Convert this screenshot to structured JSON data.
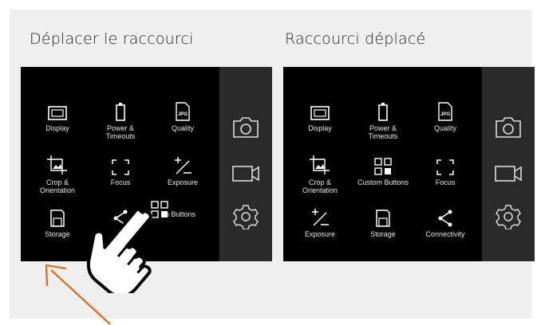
{
  "left": {
    "title": "Déplacer le raccourci",
    "tiles": [
      {
        "label": "Display",
        "icon": "display-icon"
      },
      {
        "label": "Power &\nTimeouts",
        "icon": "battery-icon"
      },
      {
        "label": "Quality",
        "icon": "jpg-file-icon"
      },
      {
        "label": "Crop &\nOrientation",
        "icon": "crop-icon"
      },
      {
        "label": "Focus",
        "icon": "focus-frame-icon"
      },
      {
        "label": "Exposure",
        "icon": "plus-minus-icon"
      },
      {
        "label": "Storage",
        "icon": "sd-card-icon"
      },
      {
        "label": "",
        "icon": "share-icon"
      },
      {
        "label": "n Buttons",
        "icon": "grid-icon"
      }
    ]
  },
  "right": {
    "title": "Raccourci déplacé",
    "tiles": [
      {
        "label": "Display",
        "icon": "display-icon"
      },
      {
        "label": "Power &\nTimeouts",
        "icon": "battery-icon"
      },
      {
        "label": "Quality",
        "icon": "jpg-file-icon"
      },
      {
        "label": "Crop &\nOrientation",
        "icon": "crop-icon"
      },
      {
        "label": "Custom Buttons",
        "icon": "grid-icon"
      },
      {
        "label": "Focus",
        "icon": "focus-frame-icon"
      },
      {
        "label": "Exposure",
        "icon": "plus-minus-icon"
      },
      {
        "label": "Storage",
        "icon": "sd-card-icon"
      },
      {
        "label": "Connectivity",
        "icon": "share-icon"
      }
    ]
  },
  "sidebar": [
    "camera-icon",
    "video-camera-icon",
    "settings-gear-icon"
  ],
  "colors": {
    "panel": "#000000",
    "sidebar": "#2a2a2a",
    "arrow": "#d9731f",
    "frame": "#efefef"
  }
}
